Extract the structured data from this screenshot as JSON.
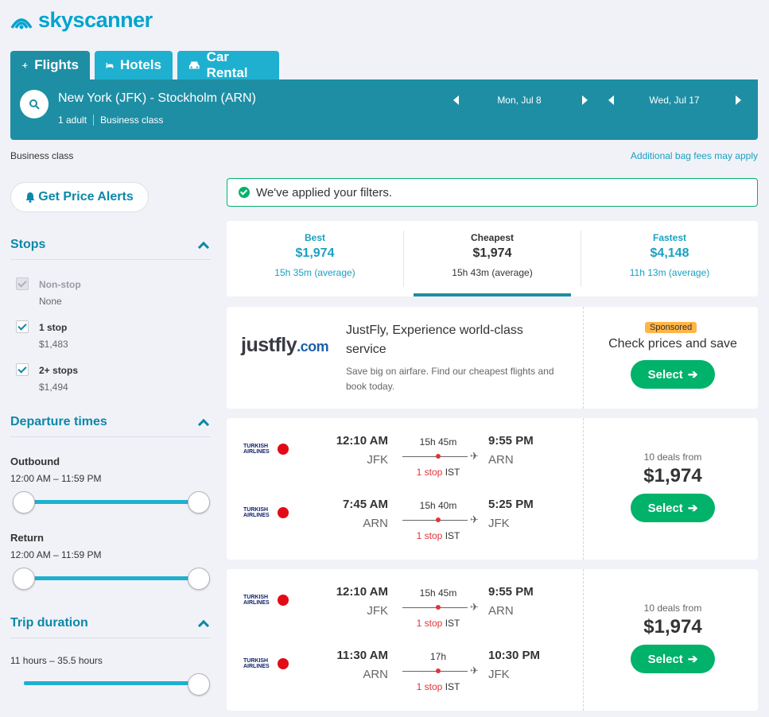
{
  "brand": {
    "name": "skyscanner"
  },
  "tabs": [
    {
      "label": "Flights",
      "icon": "plane-icon"
    },
    {
      "label": "Hotels",
      "icon": "bed-icon"
    },
    {
      "label": "Car Rental",
      "icon": "car-icon"
    }
  ],
  "search": {
    "route": "New York (JFK) - Stockholm (ARN)",
    "travellers": "1 adult",
    "cabin": "Business class",
    "depart_date": "Mon, Jul 8",
    "return_date": "Wed, Jul 17"
  },
  "subheader": {
    "cabin": "Business class",
    "bag_fees": "Additional bag fees may apply"
  },
  "alerts_button": "Get Price Alerts",
  "filters": {
    "stops": {
      "title": "Stops",
      "options": [
        {
          "label": "Non-stop",
          "sub": "None",
          "checked": true,
          "disabled": true
        },
        {
          "label": "1 stop",
          "sub": "$1,483",
          "checked": true
        },
        {
          "label": "2+ stops",
          "sub": "$1,494",
          "checked": true
        }
      ]
    },
    "departure": {
      "title": "Departure times",
      "outbound_label": "Outbound",
      "outbound_range": "12:00 AM – 11:59 PM",
      "return_label": "Return",
      "return_range": "12:00 AM – 11:59 PM"
    },
    "duration": {
      "title": "Trip duration",
      "range": "11 hours – 35.5 hours"
    }
  },
  "applied_msg": "We've applied your filters.",
  "sort": [
    {
      "name": "Best",
      "price": "$1,974",
      "duration": "15h 35m (average)"
    },
    {
      "name": "Cheapest",
      "price": "$1,974",
      "duration": "15h 43m (average)",
      "active": true
    },
    {
      "name": "Fastest",
      "price": "$4,148",
      "duration": "11h 13m (average)"
    }
  ],
  "ad": {
    "logo_a": "justfly",
    "logo_b": ".com",
    "title": "JustFly, Experience world-class service",
    "desc": "Save big on airfare. Find our cheapest flights and book today.",
    "badge": "Sponsored",
    "cta_text": "Check prices and save",
    "button": "Select"
  },
  "results": [
    {
      "deals": "10 deals from",
      "price": "$1,974",
      "button": "Select",
      "legs": [
        {
          "airline": "TURKISH AIRLINES",
          "dep_time": "12:10 AM",
          "dep_airport": "JFK",
          "duration": "15h 45m",
          "stops": "1 stop",
          "via": "IST",
          "arr_time": "9:55 PM",
          "arr_airport": "ARN"
        },
        {
          "airline": "TURKISH AIRLINES",
          "dep_time": "7:45 AM",
          "dep_airport": "ARN",
          "duration": "15h 40m",
          "stops": "1 stop",
          "via": "IST",
          "arr_time": "5:25 PM",
          "arr_airport": "JFK"
        }
      ]
    },
    {
      "deals": "10 deals from",
      "price": "$1,974",
      "button": "Select",
      "legs": [
        {
          "airline": "TURKISH AIRLINES",
          "dep_time": "12:10 AM",
          "dep_airport": "JFK",
          "duration": "15h 45m",
          "stops": "1 stop",
          "via": "IST",
          "arr_time": "9:55 PM",
          "arr_airport": "ARN"
        },
        {
          "airline": "TURKISH AIRLINES",
          "dep_time": "11:30 AM",
          "dep_airport": "ARN",
          "duration": "17h",
          "stops": "1 stop",
          "via": "IST",
          "arr_time": "10:30 PM",
          "arr_airport": "JFK"
        }
      ]
    }
  ],
  "colors": {
    "teal": "#1e8ea4",
    "light_teal": "#1fb0d0",
    "green": "#00b26a",
    "red": "#e0343b"
  }
}
